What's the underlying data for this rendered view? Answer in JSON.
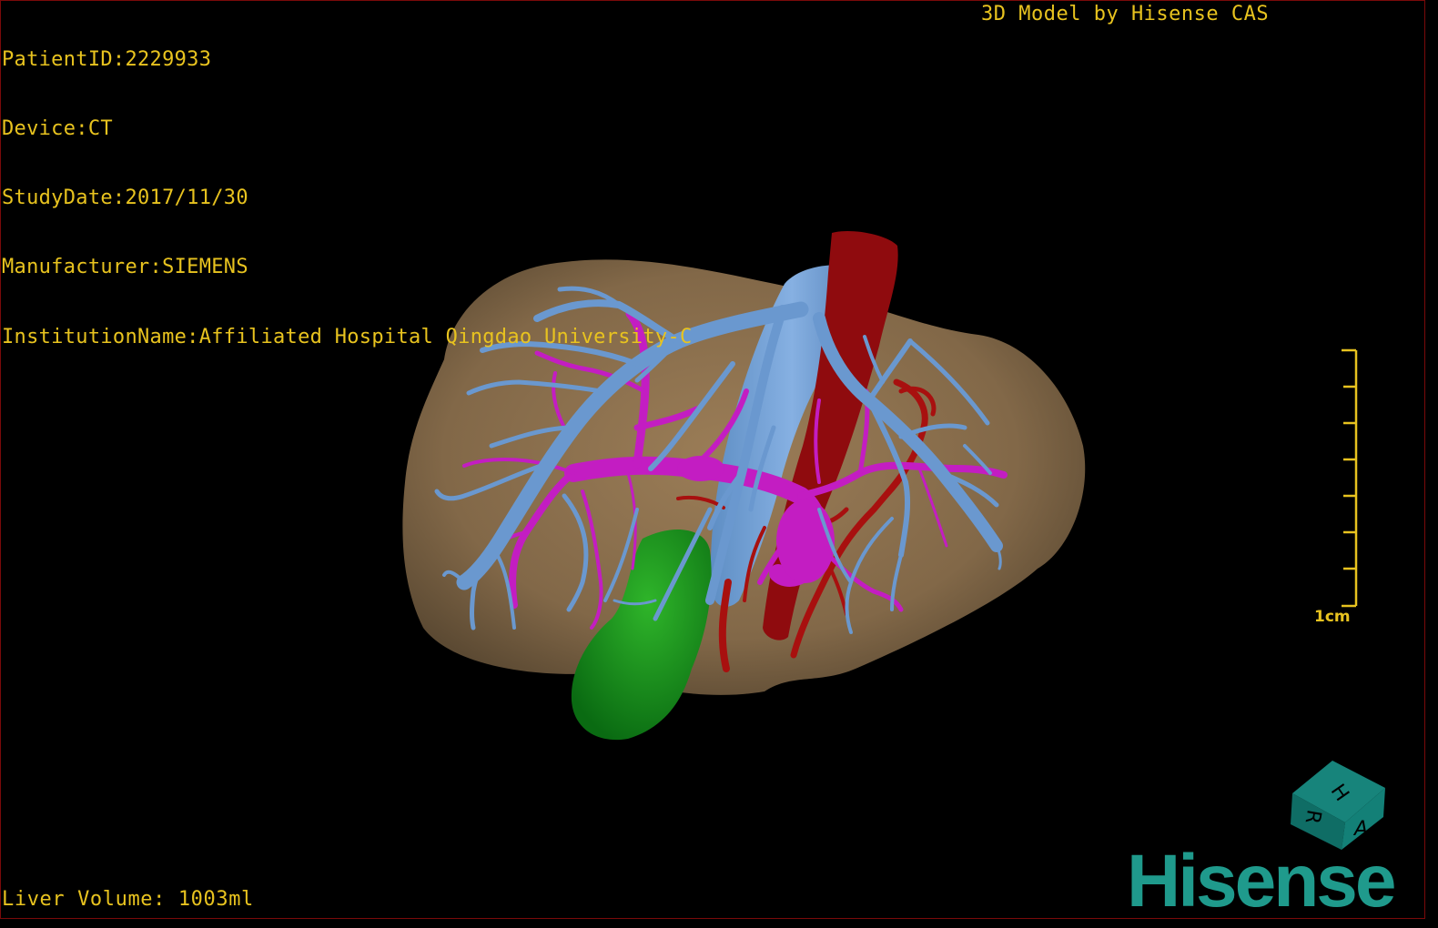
{
  "overlay": {
    "patient_id": "PatientID:2229933",
    "device": "Device:CT",
    "study_date": "StudyDate:2017/11/30",
    "manufacturer": "Manufacturer:SIEMENS",
    "institution": "InstitutionName:Affiliated Hospital Qingdao University-C",
    "credit": "3D Model by Hisense CAS",
    "liver_volume": "Liver Volume: 1003ml"
  },
  "scale_bar": {
    "label": "1cm"
  },
  "orientation_cube": {
    "faces": [
      "H",
      "R",
      "A"
    ],
    "icon": "orientation-cube-icon"
  },
  "logo": {
    "text": "Hisense"
  },
  "colors": {
    "overlay_text": "#e8c31f",
    "liver": "#8a6f4d",
    "hepatic_vein": "#6d9ad0",
    "portal_vein": "#c61fc4",
    "artery_vessel": "#9a0c0e",
    "gallbladder": "#0e8a1c",
    "logo": "#1f9a8c"
  }
}
